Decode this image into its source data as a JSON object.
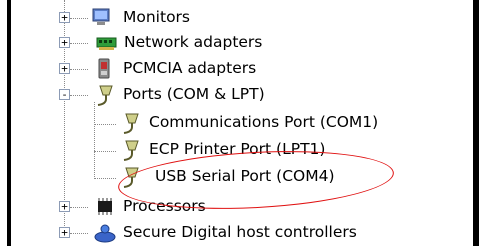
{
  "tree": {
    "items": [
      {
        "label": "Monitors",
        "toggle": "+",
        "icon": "monitor-icon"
      },
      {
        "label": "Network adapters",
        "toggle": "+",
        "icon": "network-adapter-icon"
      },
      {
        "label": "PCMCIA adapters",
        "toggle": "+",
        "icon": "pcmcia-card-icon"
      },
      {
        "label": "Ports (COM & LPT)",
        "toggle": "-",
        "icon": "port-connector-icon"
      },
      {
        "label": "Communications Port (COM1)",
        "icon": "port-connector-icon"
      },
      {
        "label": "ECP Printer Port (LPT1)",
        "icon": "port-connector-icon"
      },
      {
        "label": "USB Serial Port (COM4)",
        "icon": "port-connector-icon"
      },
      {
        "label": "Processors",
        "toggle": "+",
        "icon": "processor-chip-icon"
      },
      {
        "label": "Secure Digital host controllers",
        "toggle": "+",
        "icon": "sd-controller-icon"
      }
    ]
  },
  "annotation": {
    "color": "#e01010"
  }
}
